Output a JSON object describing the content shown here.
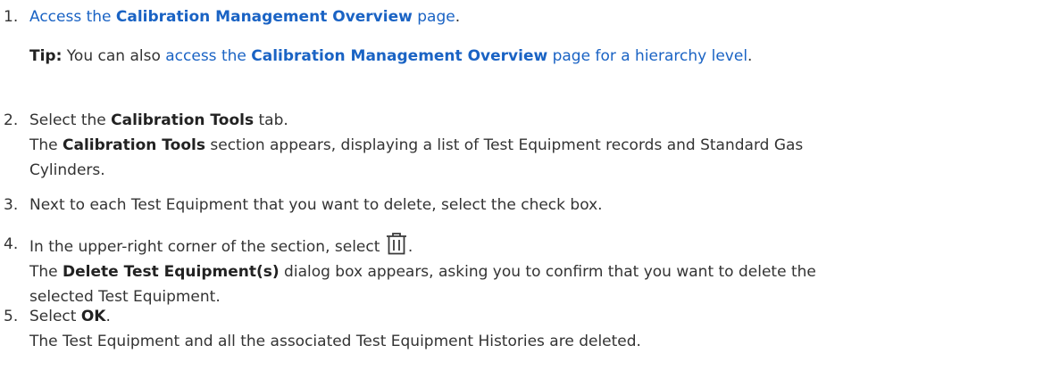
{
  "steps": [
    {
      "num": "1.",
      "pre": "",
      "link_pre": "Access the ",
      "link_bold": "Calibration Management Overview",
      "link_post": " page",
      "post": ".",
      "tip": {
        "label": "Tip:",
        "text": " You can also ",
        "link_pre": "access the ",
        "link_bold": "Calibration Management Overview",
        "link_post": " page for a hierarchy level",
        "post": "."
      }
    },
    {
      "num": "2.",
      "pre": "Select the ",
      "bold": "Calibration Tools",
      "post": " tab.",
      "result_bold": "The ",
      "result_b": "Calibration Tools",
      "result_text1": " section appears, displaying a list of Test Equipment records and Standard Gas",
      "result_text2": "Cylinders."
    },
    {
      "num": "3.",
      "text": "Next to each Test Equipment that you want to delete, select the check box."
    },
    {
      "num": "4.",
      "pre": "In the upper-right corner of the section, select ",
      "post": ".",
      "result_pre": "The ",
      "result_bold": "Delete Test Equipment(s)",
      "result_text1": " dialog box appears, asking you to confirm that you want to delete the",
      "result_text2": "selected Test Equipment."
    },
    {
      "num": "5.",
      "pre": "Select ",
      "bold": "OK",
      "post": ".",
      "result_text": "The Test Equipment and all the associated Test Equipment Histories are deleted."
    }
  ],
  "icons": {
    "delete": "trash-icon"
  },
  "colors": {
    "link": "#1a63c4",
    "text": "#333333"
  }
}
